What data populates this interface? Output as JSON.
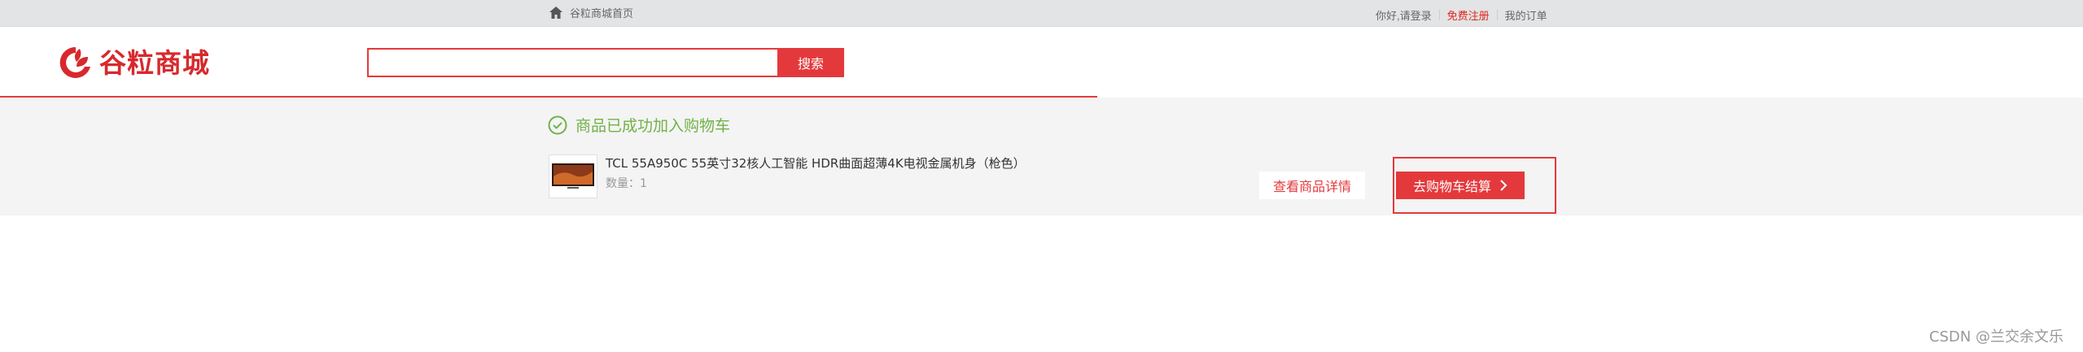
{
  "topbar": {
    "home_label": "谷粒商城首页",
    "greeting": "你好,请登录",
    "register": "免费注册",
    "my_orders": "我的订单"
  },
  "header": {
    "logo_text": "谷粒商城",
    "search_value": "",
    "search_button": "搜索"
  },
  "success": {
    "message": "商品已成功加入购物车",
    "product_name": "TCL 55A950C 55英寸32核人工智能 HDR曲面超薄4K电视金属机身（枪色）",
    "quantity": "数量：1",
    "detail_button": "查看商品详情",
    "checkout_button": "去购物车结算"
  },
  "watermark": "CSDN @兰交余文乐",
  "colors": {
    "brand_red": "#e4393c",
    "success_green": "#71b247"
  }
}
